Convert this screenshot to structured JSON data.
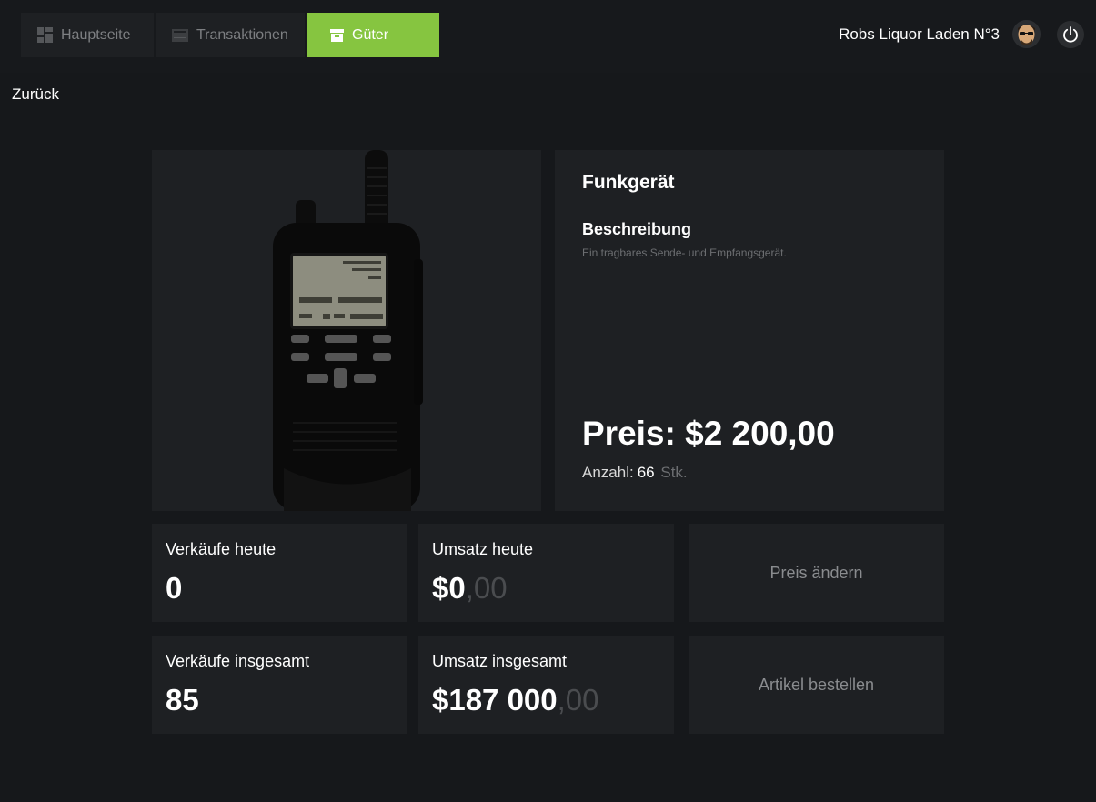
{
  "nav": {
    "tabs": [
      {
        "label": "Hauptseite",
        "icon": "dashboard-icon",
        "active": false
      },
      {
        "label": "Transaktionen",
        "icon": "list-icon",
        "active": false
      },
      {
        "label": "Güter",
        "icon": "box-icon",
        "active": true
      }
    ]
  },
  "header": {
    "shop_name": "Robs Liquor Laden N°3",
    "avatar_icon": "avatar-icon",
    "power_icon": "power-icon"
  },
  "back_label": "Zurück",
  "product": {
    "title": "Funkgerät",
    "description_heading": "Beschreibung",
    "description": "Ein tragbares Sende- und Empfangsgerät.",
    "price_label": "Preis: $2 200,00",
    "stock_label": "Anzahl:",
    "stock_value": "66",
    "stock_unit": "Stk."
  },
  "stats": {
    "sales_today": {
      "label": "Verkäufe heute",
      "value": "0"
    },
    "revenue_today": {
      "label": "Umsatz heute",
      "value_main": "$0",
      "value_cents": ",00"
    },
    "sales_total": {
      "label": "Verkäufe insgesamt",
      "value": "85"
    },
    "revenue_total": {
      "label": "Umsatz insgesamt",
      "value_main": "$187 000",
      "value_cents": ",00"
    }
  },
  "actions": {
    "change_price": "Preis ändern",
    "order_item": "Artikel bestellen"
  },
  "colors": {
    "accent": "#86c540",
    "background": "#16181b",
    "card": "#1e2023",
    "muted_text": "#6c6e71"
  }
}
